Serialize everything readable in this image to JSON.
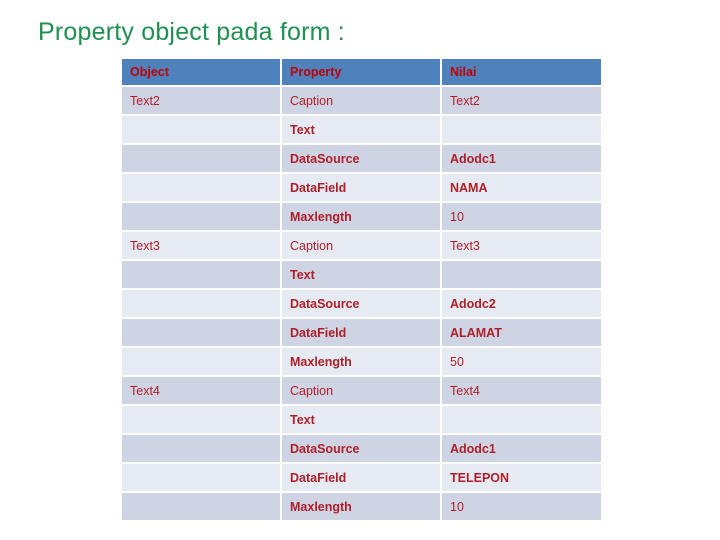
{
  "slide": {
    "title": "Property object pada form :",
    "title_color": "#1e9150"
  },
  "table": {
    "header_bg": "#4f81bd",
    "header_text_color": "#c00000",
    "body_text_color": "#b01f28",
    "row_dark_bg": "#ced4e3",
    "row_light_bg": "#e6eaf2",
    "columns": [
      "Object",
      "Property",
      "Nilai"
    ],
    "rows": [
      {
        "object": "Text2",
        "property": "Caption",
        "nilai": "Text2",
        "bold": false,
        "shade": "dark"
      },
      {
        "object": "",
        "property": "Text",
        "nilai": "",
        "bold": true,
        "shade": "light"
      },
      {
        "object": "",
        "property": "DataSource",
        "nilai": "Adodc1",
        "bold": true,
        "shade": "dark"
      },
      {
        "object": "",
        "property": "DataField",
        "nilai": "NAMA",
        "bold": true,
        "shade": "light"
      },
      {
        "object": "",
        "property": "Maxlength",
        "nilai": "10",
        "bold": true,
        "shade": "dark"
      },
      {
        "object": "Text3",
        "property": "Caption",
        "nilai": "Text3",
        "bold": false,
        "shade": "light"
      },
      {
        "object": "",
        "property": "Text",
        "nilai": "",
        "bold": true,
        "shade": "dark"
      },
      {
        "object": "",
        "property": "DataSource",
        "nilai": "Adodc2",
        "bold": true,
        "shade": "light"
      },
      {
        "object": "",
        "property": "DataField",
        "nilai": "ALAMAT",
        "bold": true,
        "shade": "dark"
      },
      {
        "object": "",
        "property": "Maxlength",
        "nilai": "50",
        "bold": true,
        "shade": "light"
      },
      {
        "object": "Text4",
        "property": "Caption",
        "nilai": "Text4",
        "bold": false,
        "shade": "dark"
      },
      {
        "object": "",
        "property": "Text",
        "nilai": "",
        "bold": true,
        "shade": "light"
      },
      {
        "object": "",
        "property": "DataSource",
        "nilai": "Adodc1",
        "bold": true,
        "shade": "dark"
      },
      {
        "object": "",
        "property": "DataField",
        "nilai": "TELEPON",
        "bold": true,
        "shade": "light"
      },
      {
        "object": "",
        "property": "Maxlength",
        "nilai": "10",
        "bold": true,
        "shade": "dark"
      }
    ]
  }
}
